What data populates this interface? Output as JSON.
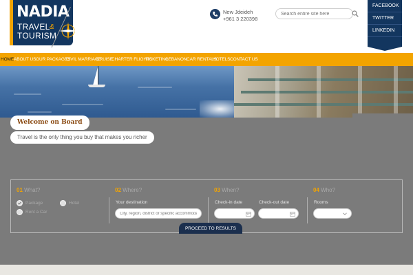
{
  "logo": {
    "title": "NADIA",
    "sub1": "TRAVEL",
    "amp": "&",
    "sub2": "TOURISM"
  },
  "contact": {
    "city": "New Jdeideh",
    "phone": "+961 3 220398"
  },
  "search": {
    "placeholder": "Search entire site here"
  },
  "social": [
    "FACEBOOK",
    "TWITTER",
    "LINKEDIN"
  ],
  "nav": [
    "HOME",
    "ABOUT US",
    "OUR PACKAGES",
    "CIVIL MARRIAGE",
    "CRUISE",
    "CHARTER FLIGHTS",
    "TICKETING",
    "LEBANON",
    "CAR RENTALS",
    "HOTELS",
    "CONTACT US"
  ],
  "welcome": {
    "title": "Welcome on Board",
    "tagline": "Travel is the only thing you buy that makes you richer"
  },
  "panel": {
    "steps": [
      {
        "num": "01",
        "label": "What?"
      },
      {
        "num": "02",
        "label": "Where?"
      },
      {
        "num": "03",
        "label": "When?"
      },
      {
        "num": "04",
        "label": "Who?"
      }
    ],
    "what": {
      "package": "Package",
      "hotel": "Hotel",
      "car": "Rent a Car"
    },
    "where": {
      "label": "Your destination",
      "placeholder": "City, region, district or specific accommodation"
    },
    "when": {
      "checkin": "Check-in date",
      "checkout": "Check-out date"
    },
    "who": {
      "rooms": "Rooms"
    },
    "proceed": "PROCEED TO RESULTS"
  },
  "colors": {
    "accent": "#f3a400",
    "navy": "#13365f",
    "panel_bg": "#7b7b7b"
  }
}
